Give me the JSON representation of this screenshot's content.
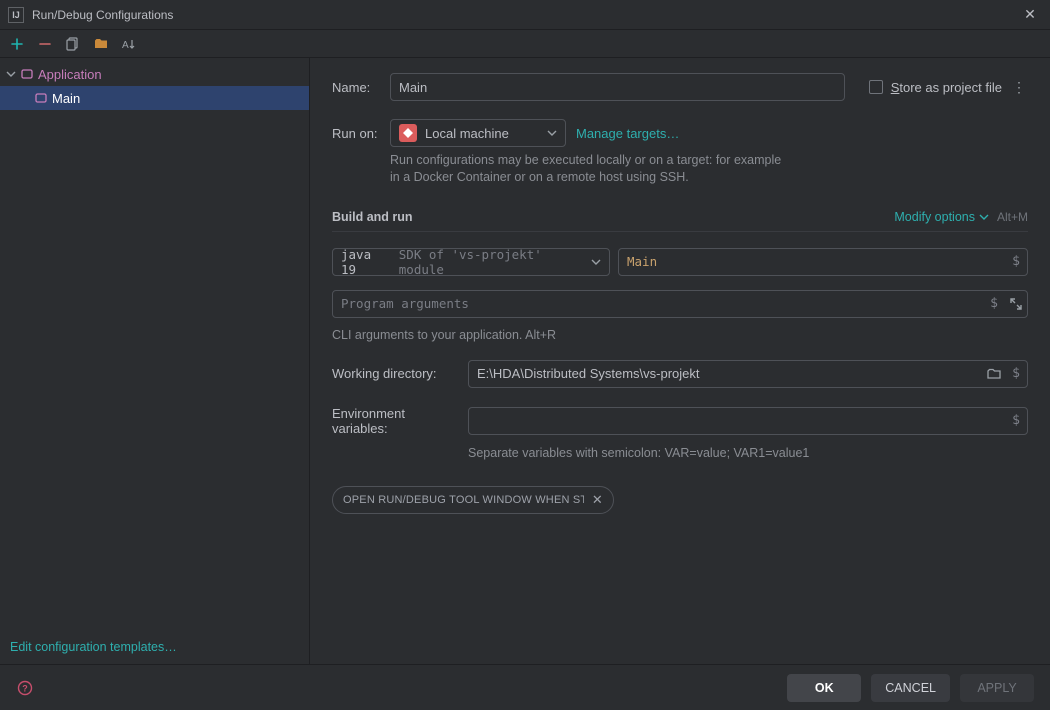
{
  "window": {
    "title": "Run/Debug Configurations",
    "app_icon_text": "IJ"
  },
  "sidebar": {
    "group_label": "Application",
    "item_label": "Main",
    "edit_templates": "Edit configuration templates…"
  },
  "form": {
    "name_label": "Name:",
    "name_value": "Main",
    "store_label": "tore as project file",
    "store_prefix": "S",
    "runon_label": "Run on:",
    "runon_value": "Local machine",
    "manage_targets": "Manage targets…",
    "runon_help": "Run configurations may be executed locally or on a target: for example in a Docker Container or on a remote host using SSH.",
    "section_title": "Build and run",
    "modify_options": "Modify options",
    "modify_shortcut": "Alt+M",
    "sdk_prefix": "java 19",
    "sdk_suffix": "SDK of 'vs-projekt' module",
    "main_class": "Main",
    "prog_args_placeholder": "Program arguments",
    "cli_help": "CLI arguments to your application. Alt+R",
    "workdir_label": "Working directory:",
    "workdir_value": "E:\\HDA\\Distributed Systems\\vs-projekt",
    "env_label": "Environment variables:",
    "env_value": "",
    "env_help": "Separate variables with semicolon: VAR=value; VAR1=value1",
    "chip_label": "OPEN RUN/DEBUG TOOL WINDOW WHEN STARTED"
  },
  "footer": {
    "ok": "OK",
    "cancel": "CANCEL",
    "apply": "APPLY"
  }
}
